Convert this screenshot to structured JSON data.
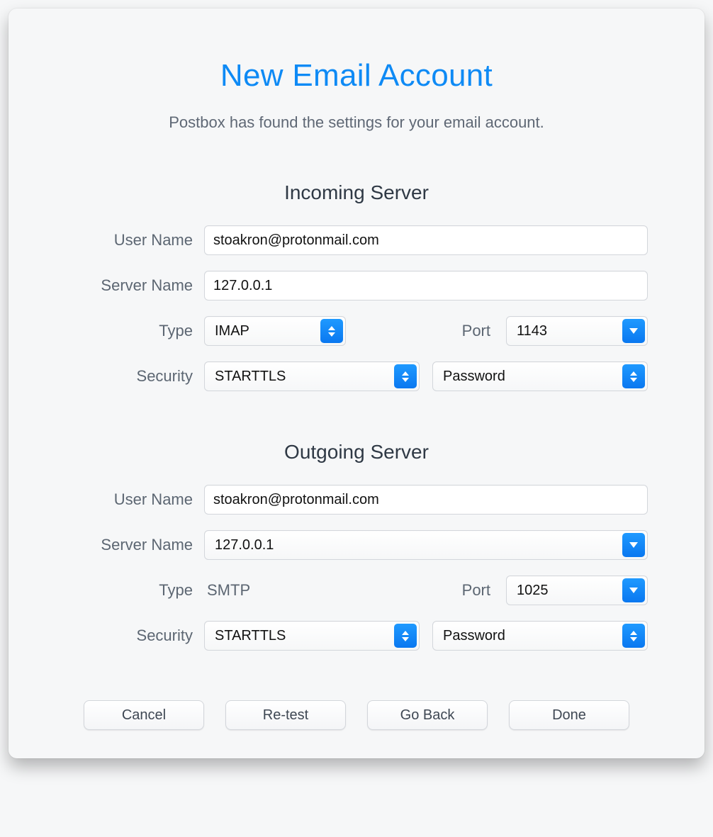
{
  "title": "New Email Account",
  "subtitle": "Postbox has found the settings for your email account.",
  "labels": {
    "user_name": "User Name",
    "server_name": "Server Name",
    "type": "Type",
    "port": "Port",
    "security": "Security"
  },
  "incoming": {
    "heading": "Incoming Server",
    "user_name": "stoakron@protonmail.com",
    "server_name": "127.0.0.1",
    "type": "IMAP",
    "port": "1143",
    "security": "STARTTLS",
    "auth": "Password"
  },
  "outgoing": {
    "heading": "Outgoing Server",
    "user_name": "stoakron@protonmail.com",
    "server_name": "127.0.0.1",
    "type": "SMTP",
    "port": "1025",
    "security": "STARTTLS",
    "auth": "Password"
  },
  "buttons": {
    "cancel": "Cancel",
    "retest": "Re-test",
    "goback": "Go Back",
    "done": "Done"
  }
}
